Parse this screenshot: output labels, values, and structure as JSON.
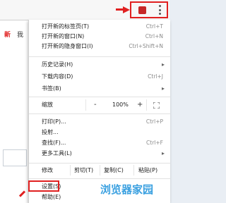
{
  "menu": {
    "new_tab": {
      "label": "打开新的标签页(T)",
      "shortcut": "Ctrl+T"
    },
    "new_window": {
      "label": "打开新的窗口(N)",
      "shortcut": "Ctrl+N"
    },
    "incognito": {
      "label": "打开新的隐身窗口(I)",
      "shortcut": "Ctrl+Shift+N"
    },
    "history": {
      "label": "历史记录(H)"
    },
    "downloads": {
      "label": "下载内容(D)",
      "shortcut": "Ctrl+J"
    },
    "bookmarks": {
      "label": "书签(B)"
    },
    "zoom": {
      "label": "缩放",
      "minus": "-",
      "value": "100%",
      "plus": "+"
    },
    "print": {
      "label": "打印(P)...",
      "shortcut": "Ctrl+P"
    },
    "cast": {
      "label": "投射..."
    },
    "find": {
      "label": "查找(F)...",
      "shortcut": "Ctrl+F"
    },
    "more_tools": {
      "label": "更多工具(L)"
    },
    "edit": {
      "label": "修改",
      "cut": "剪切(T)",
      "copy": "复制(C)",
      "paste": "粘贴(P)"
    },
    "settings": {
      "label": "设置(S)"
    },
    "help": {
      "label": "帮助(E)"
    }
  },
  "page": {
    "mark1": "新",
    "mark2": "我"
  },
  "watermark": "浏览器家园",
  "colors": {
    "highlight": "#e02020",
    "watermark": "#3aa0e0"
  }
}
